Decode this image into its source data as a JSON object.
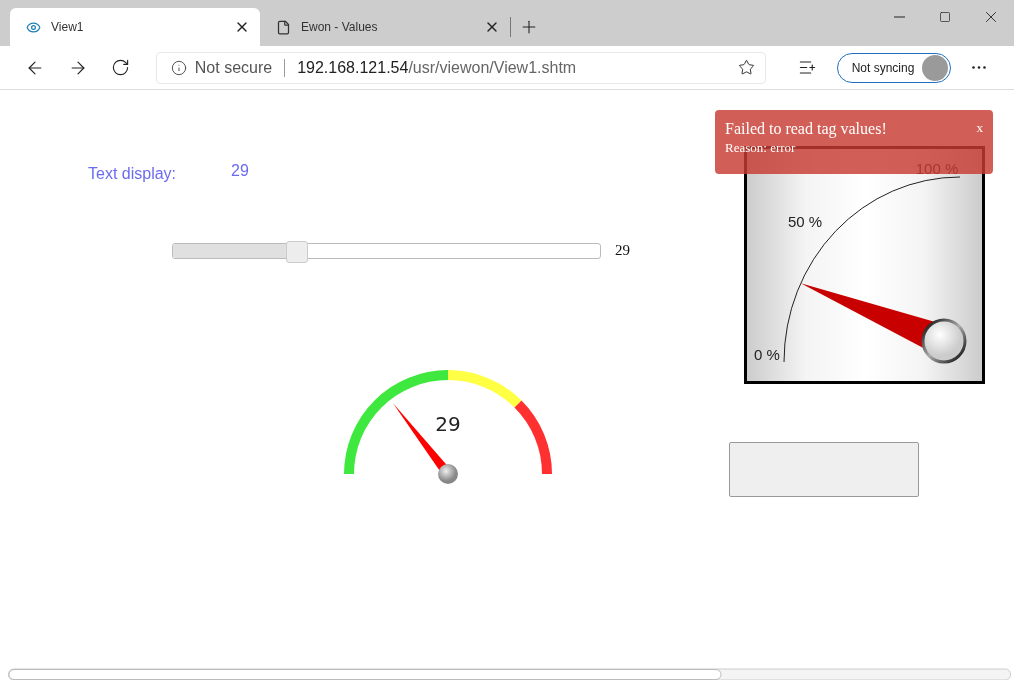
{
  "tabs": [
    {
      "title": "View1",
      "selected": true
    },
    {
      "title": "Ewon - Values",
      "selected": false
    }
  ],
  "address": {
    "security": "Not secure",
    "host": "192.168.121.54",
    "path": "/usr/viewon/View1.shtm"
  },
  "profile": {
    "label": "Not syncing"
  },
  "page": {
    "text_display": {
      "label": "Text display:",
      "value": "29"
    },
    "slider": {
      "level": 0.29,
      "reading": "29"
    },
    "arc_gauge": {
      "level": 0.29,
      "reading": "29"
    },
    "quarter_gauge": {
      "level": 0.28,
      "labels": [
        "0 %",
        "50 %",
        "100 %"
      ]
    },
    "toast": {
      "title": "Failed to read tag values!",
      "message": "Reason: error",
      "close": "x"
    }
  }
}
